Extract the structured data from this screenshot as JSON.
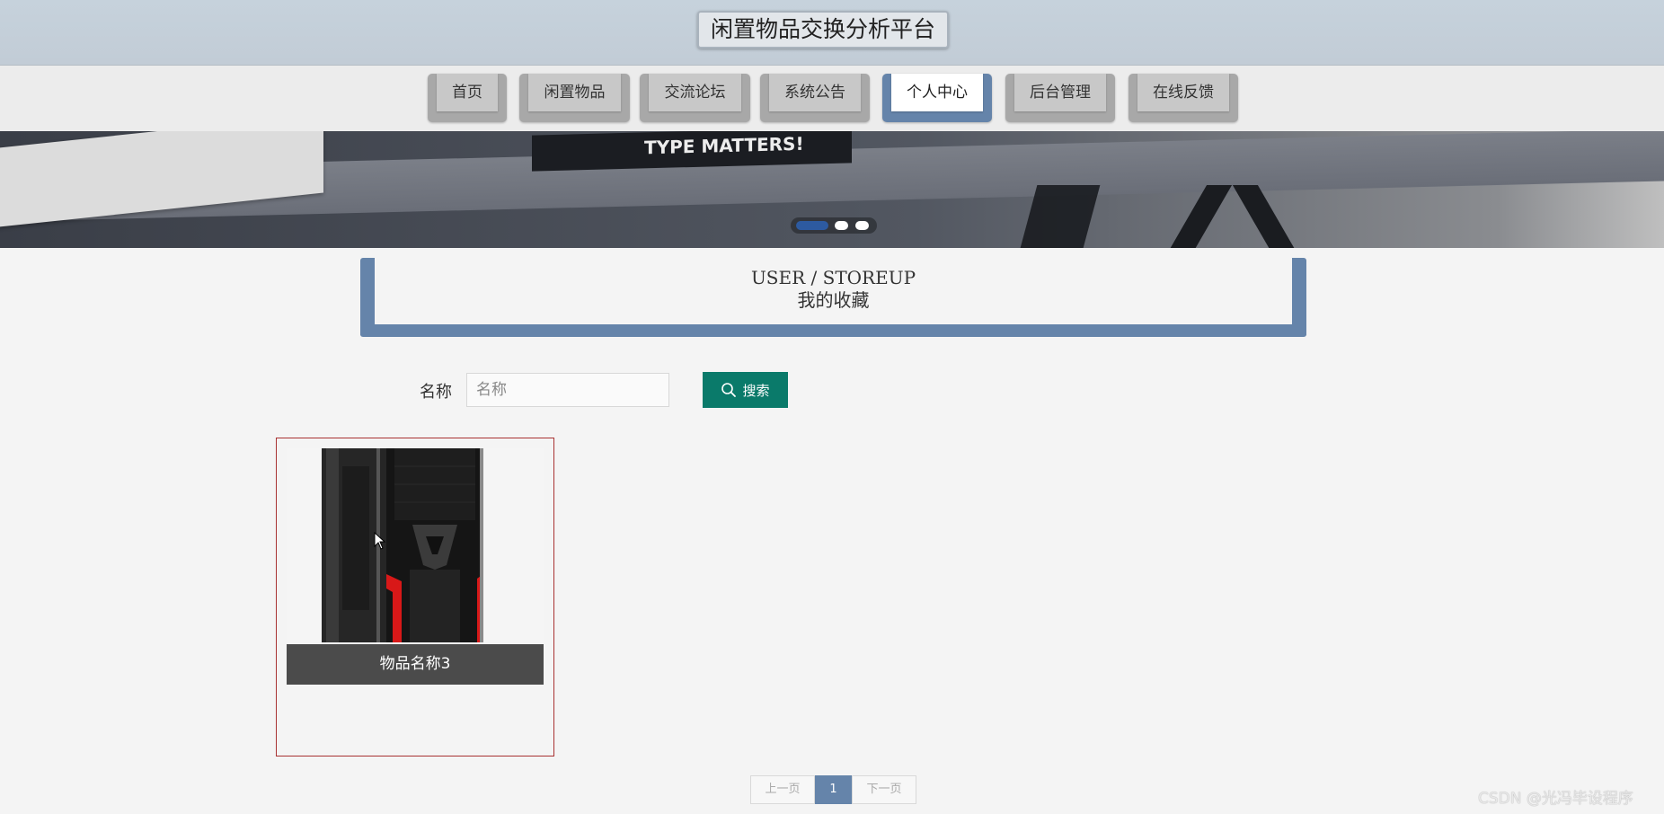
{
  "header": {
    "title": "闲置物品交换分析平台"
  },
  "nav": {
    "items": [
      {
        "label": "首页"
      },
      {
        "label": "闲置物品"
      },
      {
        "label": "交流论坛"
      },
      {
        "label": "系统公告"
      },
      {
        "label": "个人中心",
        "active": true
      },
      {
        "label": "后台管理"
      },
      {
        "label": "在线反馈"
      }
    ]
  },
  "banner": {
    "book_text": "TYPE MATTERS!",
    "active_slide": 1,
    "slide_count": 3
  },
  "section": {
    "title_en": "USER / STOREUP",
    "title_cn": "我的收藏"
  },
  "search": {
    "label": "名称",
    "placeholder": "名称",
    "value": "",
    "button_label": "搜索",
    "icon": "search-icon"
  },
  "items": [
    {
      "name": "物品名称3"
    }
  ],
  "pagination": {
    "prev": "上一页",
    "current": "1",
    "next": "下一页"
  },
  "watermark": "CSDN @光冯毕设程序",
  "colors": {
    "accent": "#6584aa",
    "search_button": "#0a7a6a",
    "card_border": "#a83232"
  }
}
